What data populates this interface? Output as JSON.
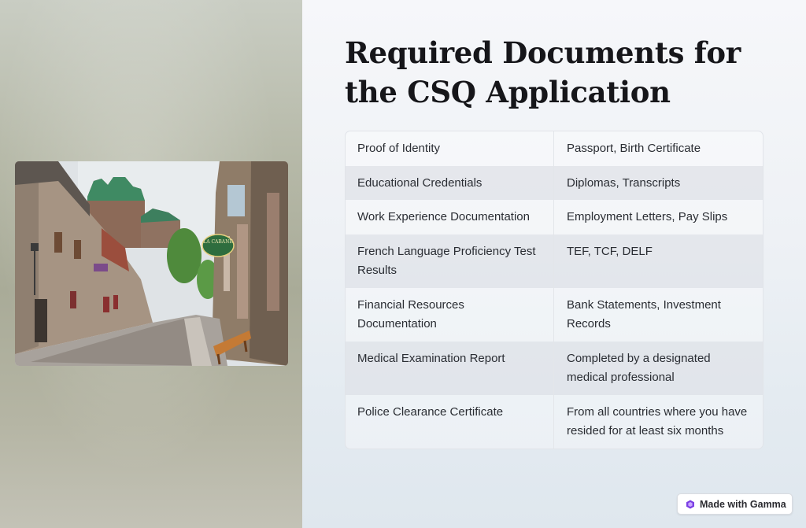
{
  "slide": {
    "title": "Required Documents for the CSQ Application"
  },
  "documents_table": {
    "rows": [
      {
        "document": "Proof of Identity",
        "examples": "Passport, Birth Certificate"
      },
      {
        "document": "Educational Credentials",
        "examples": "Diplomas, Transcripts"
      },
      {
        "document": "Work Experience Documentation",
        "examples": "Employment Letters, Pay Slips"
      },
      {
        "document": "French Language Proficiency Test Results",
        "examples": "TEF, TCF, DELF"
      },
      {
        "document": "Financial Resources Documentation",
        "examples": "Bank Statements, Investment Records"
      },
      {
        "document": "Medical Examination Report",
        "examples": "Completed by a designated medical professional"
      },
      {
        "document": "Police Clearance Certificate",
        "examples": "From all countries where you have resided for at least six months"
      }
    ]
  },
  "photo": {
    "sign_text": "LA CABANE"
  },
  "badge": {
    "label": "Made with Gamma",
    "icon": "gamma-logo-icon",
    "accent": "#7b3fe4"
  }
}
